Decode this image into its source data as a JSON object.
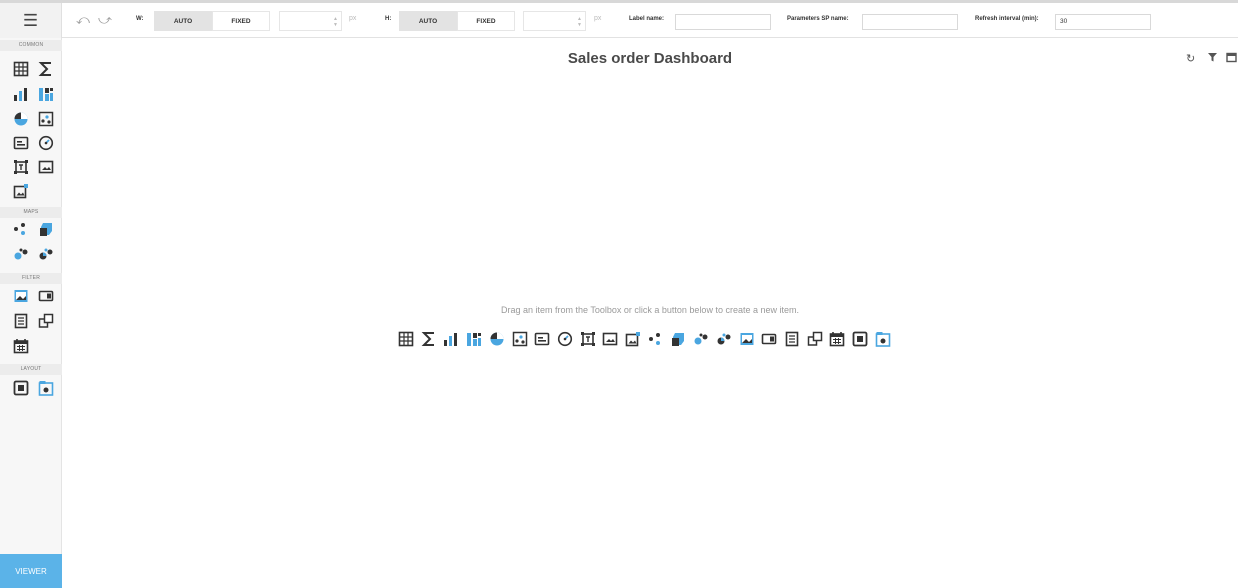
{
  "toolbar": {
    "menu_icon": "hamburger-icon",
    "undo_icon": "undo-icon",
    "redo_icon": "redo-icon",
    "width": {
      "label": "W:",
      "auto": "AUTO",
      "fixed": "FIXED",
      "unit": "px",
      "selected": "AUTO"
    },
    "height": {
      "label": "H:",
      "auto": "AUTO",
      "fixed": "FIXED",
      "unit": "px",
      "selected": "AUTO"
    },
    "label_name": {
      "label": "Label name:",
      "value": ""
    },
    "parameters_sp": {
      "label": "Parameters SP name:",
      "value": ""
    },
    "refresh": {
      "label": "Refresh interval (min):",
      "value": "30"
    }
  },
  "sidebar": {
    "sections": [
      {
        "label": "COMMON",
        "items": [
          "grid-icon",
          "sum-icon",
          "bar-chart-icon",
          "stacked-bar-icon",
          "pie-icon",
          "scatter-icon",
          "card-icon",
          "gauge-icon",
          "text-box-icon",
          "image-icon",
          "bound-image-icon"
        ]
      },
      {
        "label": "MAPS",
        "items": [
          "geo-point-icon",
          "choropleth-icon",
          "bubble-map-icon",
          "pie-map-icon"
        ]
      },
      {
        "label": "FILTER",
        "items": [
          "combo-box-icon",
          "list-box-icon",
          "tree-view-icon",
          "range-filter-icon",
          "date-filter-icon"
        ]
      },
      {
        "label": "LAYOUT",
        "items": [
          "group-icon",
          "tab-container-icon"
        ]
      }
    ],
    "viewer_label": "VIEWER"
  },
  "main": {
    "title": "Sales order Dashboard",
    "header_icons": [
      "refresh-icon",
      "filter-icon",
      "export-icon"
    ],
    "hint": "Drag an item from the Toolbox or click a button below to create a new item.",
    "create_icons": [
      "grid-icon",
      "sum-icon",
      "bar-chart-icon",
      "stacked-bar-icon",
      "pie-icon",
      "scatter-icon",
      "card-icon",
      "gauge-icon",
      "text-box-icon",
      "image-icon",
      "bound-image-icon",
      "geo-point-icon",
      "choropleth-icon",
      "bubble-map-icon",
      "pie-map-icon",
      "combo-box-icon",
      "list-box-icon",
      "tree-view-icon",
      "range-filter-icon",
      "date-filter-icon",
      "group-icon",
      "tab-container-icon"
    ]
  },
  "colors": {
    "accent": "#5bb3e8",
    "icon_blue": "#4aa6e0",
    "icon_dark": "#333333"
  }
}
